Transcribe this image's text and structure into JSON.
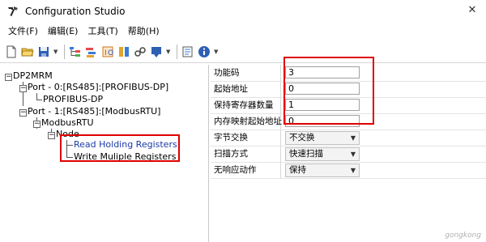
{
  "window": {
    "title": "Configuration Studio"
  },
  "menu": [
    {
      "label": "文件(F)"
    },
    {
      "label": "编辑(E)"
    },
    {
      "label": "工具(T)"
    },
    {
      "label": "帮助(H)"
    }
  ],
  "toolbar": {
    "buttons": [
      "new-file-icon",
      "open-folder-icon",
      "save-icon",
      "tree-icon",
      "add-module-icon",
      "input-icon",
      "output-icon",
      "link-icon",
      "download-icon",
      "config-icon",
      "info-icon"
    ]
  },
  "tree": {
    "root": "DP2MRM",
    "port0": "Port - 0:[RS485]:[PROFIBUS-DP]",
    "profibus": "PROFIBUS-DP",
    "port1": "Port - 1:[RS485]:[ModbusRTU]",
    "modbus": "ModbusRTU",
    "node": "Node",
    "read": "Read Holding Registers",
    "write": "Write Muliple Registers"
  },
  "properties": [
    {
      "label": "功能码",
      "value": "3",
      "kind": "input"
    },
    {
      "label": "起始地址",
      "value": "0",
      "kind": "input"
    },
    {
      "label": "保持寄存器数量",
      "value": "1",
      "kind": "input"
    },
    {
      "label": "内存映射起始地址",
      "value": "0",
      "kind": "input"
    },
    {
      "label": "字节交换",
      "value": "不交换",
      "kind": "select"
    },
    {
      "label": "扫描方式",
      "value": "快速扫描",
      "kind": "select"
    },
    {
      "label": "无响应动作",
      "value": "保持",
      "kind": "select"
    }
  ],
  "watermark": "gongkong"
}
